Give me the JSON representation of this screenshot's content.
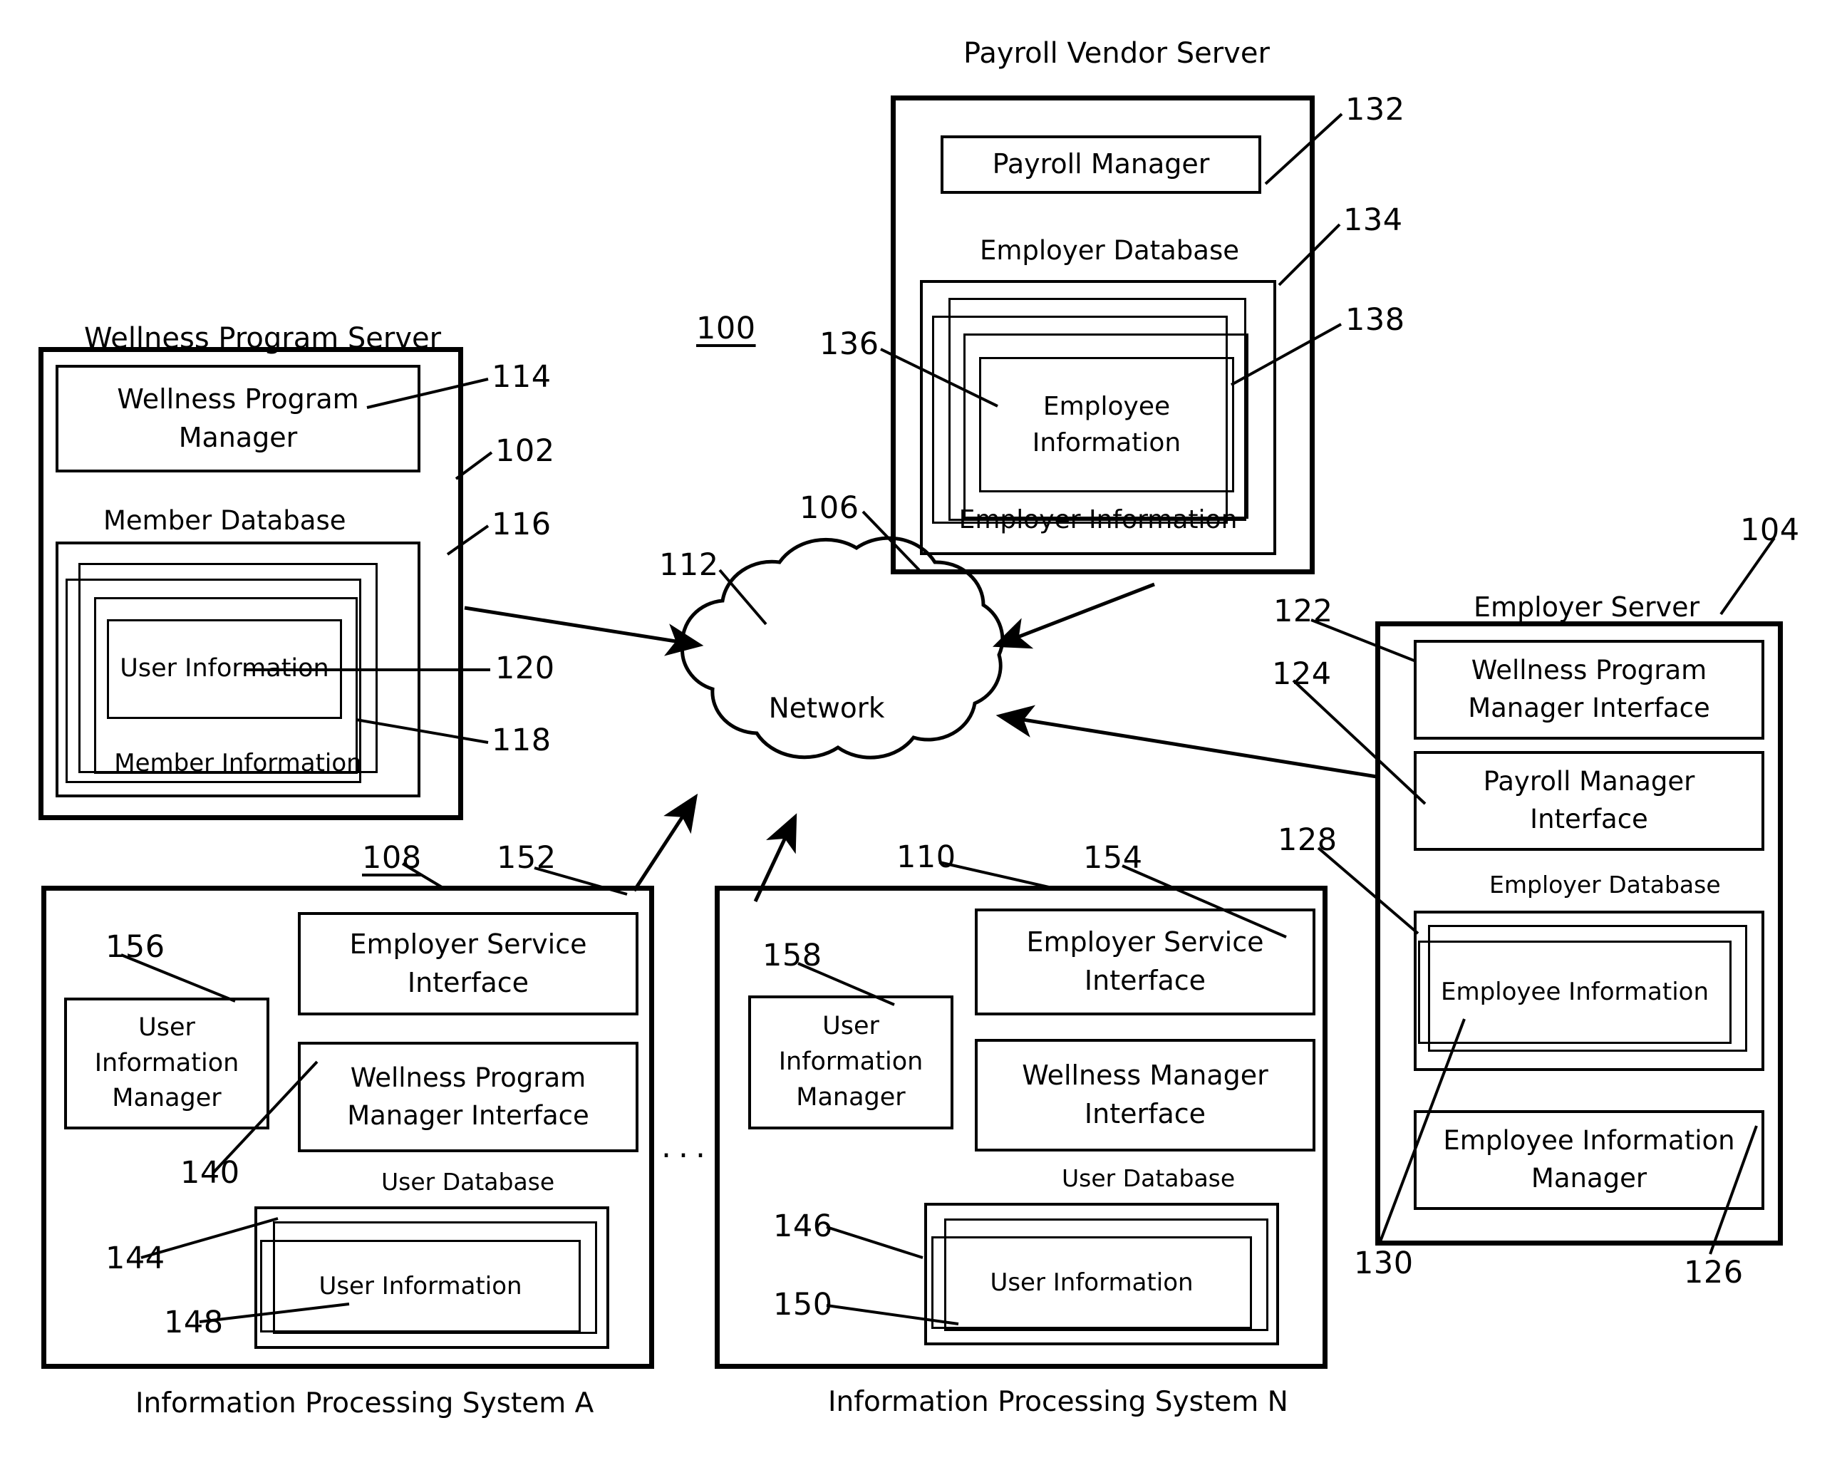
{
  "figure": {
    "number": "100",
    "title_caption_wellness_server": "Wellness Program Server",
    "title_caption_payroll_server": "Payroll Vendor Server",
    "title_caption_employer_server": "Employer Server",
    "caption_ips_a": "Information Processing System A",
    "caption_ips_n": "Information Processing System N",
    "ellipsis": "..."
  },
  "wellness_program_server": {
    "title": "Wellness Program Server",
    "ref": "102",
    "manager": {
      "label": "Wellness Program\nManager",
      "ref": "114"
    },
    "member_database": {
      "title": "Member Database",
      "ref": "116",
      "member_information": {
        "label": "Member Information",
        "ref": "118"
      },
      "user_information": {
        "label": "User Information",
        "ref": "120"
      }
    }
  },
  "payroll_vendor_server": {
    "title": "Payroll Vendor Server",
    "ref": "106",
    "payroll_manager": {
      "label": "Payroll Manager",
      "ref": "132"
    },
    "employer_database": {
      "title": "Employer Database",
      "ref": "134",
      "employer_information": {
        "label": "Employer Information",
        "ref": "136"
      },
      "employee_information": {
        "label": "Employee\nInformation",
        "ref": "138"
      }
    }
  },
  "employer_server": {
    "title": "Employer Server",
    "ref": "104",
    "wellness_program_manager_interface": {
      "label": "Wellness Program\nManager Interface",
      "ref": "122"
    },
    "payroll_manager_interface": {
      "label": "Payroll Manager\nInterface",
      "ref": "124"
    },
    "employer_database": {
      "title": "Employer Database",
      "ref": "128",
      "employee_information": {
        "label": "Employee Information",
        "ref": "130"
      }
    },
    "employee_information_manager": {
      "label": "Employee Information\nManager",
      "ref": "126"
    }
  },
  "information_processing_system_a": {
    "caption": "Information Processing System A",
    "ref": "108",
    "employer_service_interface": {
      "label": "Employer Service\nInterface",
      "ref": "152"
    },
    "user_information_manager": {
      "label": "User\nInformation\nManager",
      "ref": "156"
    },
    "wellness_program_manager_interface": {
      "label": "Wellness Program\nManager Interface",
      "ref": "140"
    },
    "user_database": {
      "title": "User Database",
      "ref": "144",
      "user_information": {
        "label": "User Information",
        "ref": "148"
      }
    }
  },
  "information_processing_system_n": {
    "caption": "Information Processing System N",
    "ref": "110",
    "employer_service_interface": {
      "label": "Employer Service\nInterface",
      "ref": "154"
    },
    "user_information_manager": {
      "label": "User\nInformation\nManager",
      "ref": "158"
    },
    "wellness_manager_interface": {
      "label": "Wellness Manager\nInterface",
      "ref": ""
    },
    "user_database": {
      "title": "User Database",
      "ref": "146",
      "user_information": {
        "label": "User Information",
        "ref": "150"
      }
    }
  },
  "network": {
    "label": "Network",
    "ref": "112"
  },
  "colors": {
    "ink": "#000000",
    "paper": "#ffffff"
  }
}
